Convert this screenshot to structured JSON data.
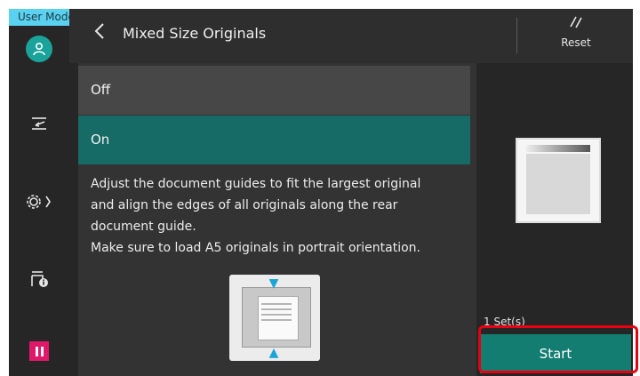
{
  "mode_tag": "User Mode",
  "header": {
    "title": "Mixed Size Originals",
    "reset_label": "Reset"
  },
  "sidebar": {
    "icons": [
      "user-icon",
      "job-flow-icon",
      "settings-icon",
      "device-info-icon",
      "pause-icon"
    ]
  },
  "options": {
    "off_label": "Off",
    "on_label": "On",
    "selected": "On"
  },
  "instructions": {
    "line1": "Adjust the document guides to fit the largest original",
    "line2": "and align the edges of all originals along the rear",
    "line3": "document guide.",
    "line4": "Make sure to load A5 originals in portrait orientation."
  },
  "right_panel": {
    "sets": "1 Set(s)",
    "start_label": "Start"
  },
  "colors": {
    "accent": "#166b66",
    "start": "#137d72",
    "highlight": "#e60012",
    "mode_tag": "#5ad1ee",
    "pause": "#e0186a"
  }
}
